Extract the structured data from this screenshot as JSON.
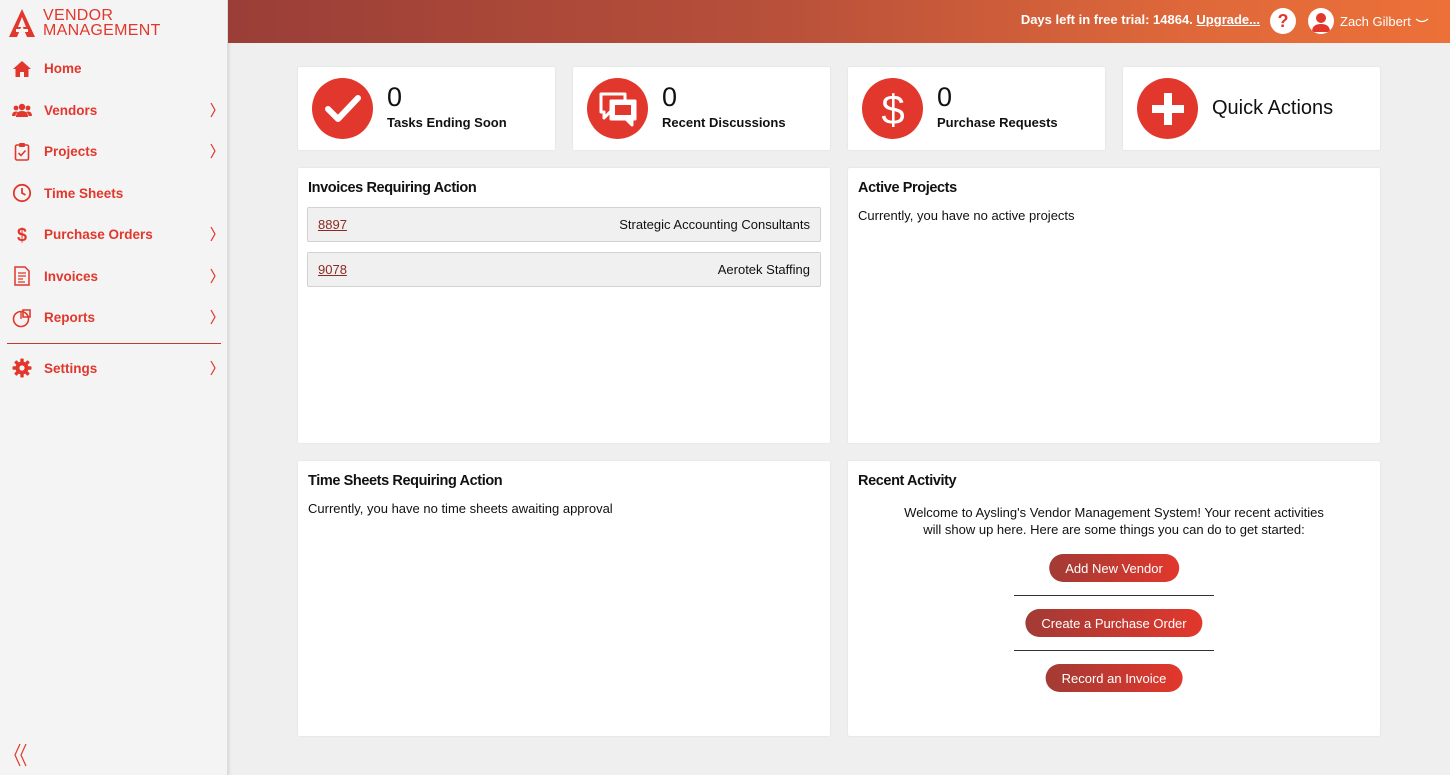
{
  "brand": {
    "line1": "VENDOR",
    "line2": "MANAGEMENT",
    "accent": "#e2372c"
  },
  "sidebar": {
    "items": [
      {
        "label": "Home",
        "icon": "home-icon",
        "has_chevron": false
      },
      {
        "label": "Vendors",
        "icon": "users-icon",
        "has_chevron": true
      },
      {
        "label": "Projects",
        "icon": "clipboard-icon",
        "has_chevron": true
      },
      {
        "label": "Time Sheets",
        "icon": "clock-icon",
        "has_chevron": false
      },
      {
        "label": "Purchase Orders",
        "icon": "dollar-icon",
        "has_chevron": true
      },
      {
        "label": "Invoices",
        "icon": "invoice-icon",
        "has_chevron": true
      },
      {
        "label": "Reports",
        "icon": "reports-icon",
        "has_chevron": true
      },
      {
        "label": "Settings",
        "icon": "gear-icon",
        "has_chevron": true
      }
    ]
  },
  "topbar": {
    "trial_text": "Days left in free trial: 14864.",
    "upgrade_label": "Upgrade...",
    "help_label": "?",
    "user_name": "Zach Gilbert"
  },
  "stats": {
    "tasks": {
      "count": "0",
      "label": "Tasks Ending Soon"
    },
    "discussions": {
      "count": "0",
      "label": "Recent Discussions"
    },
    "purchase_requests": {
      "count": "0",
      "label": "Purchase Requests"
    },
    "quick_actions": {
      "label": "Quick Actions"
    }
  },
  "invoices": {
    "title": "Invoices Requiring Action",
    "rows": [
      {
        "id": "8897",
        "vendor": "Strategic Accounting Consultants"
      },
      {
        "id": "9078",
        "vendor": "Aerotek Staffing"
      }
    ]
  },
  "active_projects": {
    "title": "Active Projects",
    "empty_text": "Currently, you have no active projects"
  },
  "time_sheets": {
    "title": "Time Sheets Requiring Action",
    "empty_text": "Currently, you have no time sheets awaiting approval"
  },
  "recent_activity": {
    "title": "Recent Activity",
    "welcome_line1": "Welcome to Aysling's Vendor Management System! Your recent activities",
    "welcome_line2": "will show up here. Here are some things you can do to get started:",
    "btn_add_vendor": "Add New Vendor",
    "btn_create_po": "Create a Purchase Order",
    "btn_record_invoice": "Record an Invoice"
  }
}
